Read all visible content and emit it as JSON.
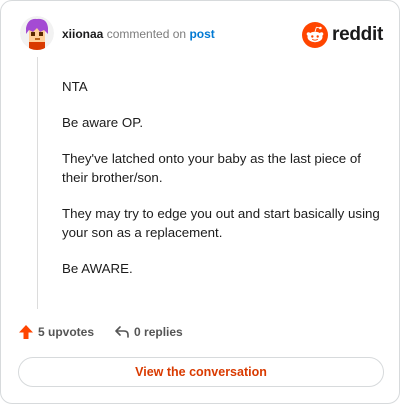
{
  "comment": {
    "username": "xiionaa",
    "commented_text": "commented on",
    "post_link": "post",
    "brand": "reddit",
    "paragraphs": [
      "NTA",
      "Be aware OP.",
      "They've latched onto your baby as the last piece of their brother/son.",
      "They may try to edge you out and start basically using your son as a replacement.",
      "Be AWARE."
    ]
  },
  "actions": {
    "upvotes": "5 upvotes",
    "replies": "0 replies"
  },
  "cta": {
    "label": "View the conversation"
  },
  "colors": {
    "accent": "#d93a00",
    "link": "#0079d3",
    "upvote": "#ff4500",
    "avatar_hair": "#a44bd3"
  },
  "icons": {
    "upvote": "upvote-arrow-icon",
    "reply": "reply-arrow-icon",
    "brand": "reddit-snoo-icon"
  }
}
